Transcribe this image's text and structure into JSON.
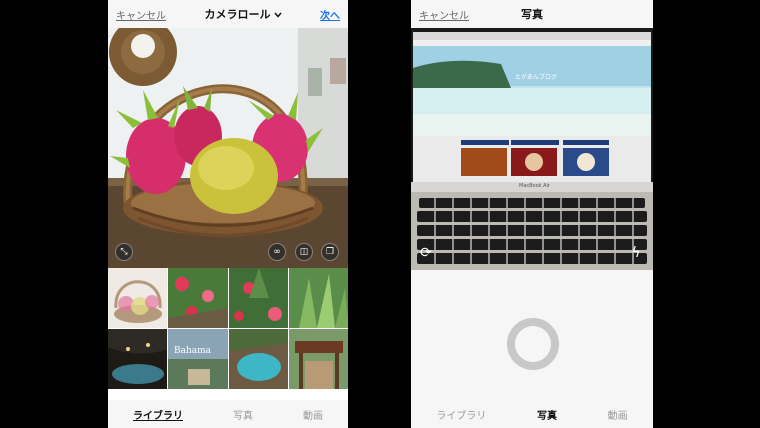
{
  "left": {
    "header": {
      "cancel": "キャンセル",
      "title": "カメラロール",
      "chevron": "chevron-down-icon",
      "next": "次へ"
    },
    "preview_buttons": [
      "expand-icon",
      "boomerang-icon",
      "layout-icon",
      "multi-select-icon"
    ],
    "thumbnails": [
      "dragon-fruit-basket",
      "red-flowers-1",
      "red-flowers-2",
      "green-plant",
      "cave-pool",
      "restaurant-sign",
      "turquoise-pool",
      "wooden-gate"
    ],
    "tabs": {
      "library": "ライブラリ",
      "photo": "写真",
      "video": "動画",
      "active": "library"
    }
  },
  "right": {
    "header": {
      "cancel": "キャンセル",
      "title": "写真"
    },
    "screen_content": {
      "blog_title": "とがあんブログ",
      "laptop_label": "MacBook Air"
    },
    "camera_buttons": [
      "switch-camera-icon",
      "flash-icon"
    ],
    "tabs": {
      "library": "ライブラリ",
      "photo": "写真",
      "video": "動画",
      "active": "photo"
    }
  }
}
